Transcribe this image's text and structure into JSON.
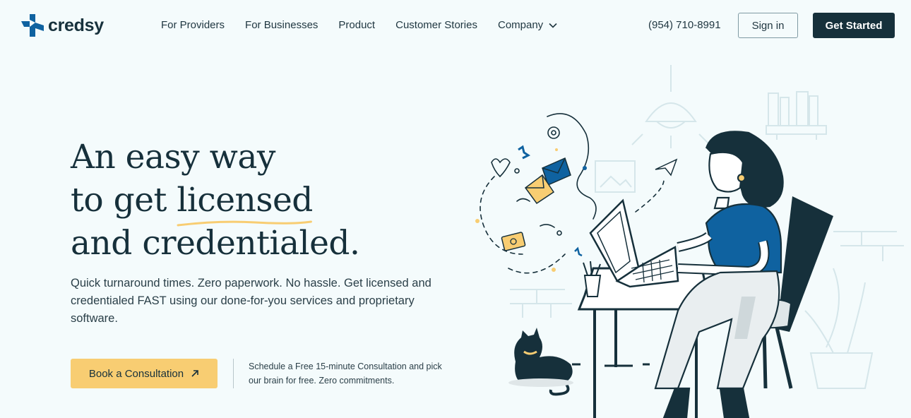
{
  "brand": {
    "name": "credsy",
    "colors": {
      "dark": "#16303b",
      "blue": "#0f62a0",
      "yellow": "#f8cd72",
      "background": "#f4fbfc"
    }
  },
  "nav": {
    "items": [
      {
        "label": "For Providers"
      },
      {
        "label": "For Businesses"
      },
      {
        "label": "Product"
      },
      {
        "label": "Customer Stories"
      },
      {
        "label": "Company",
        "icon": "chevron-down-icon"
      }
    ],
    "phone": "(954) 710-8991",
    "signin_label": "Sign in",
    "get_started_label": "Get Started"
  },
  "hero": {
    "title_line1": "An easy way",
    "title_line2_prefix": "to get ",
    "title_line2_highlight": "licensed",
    "title_line3": "and credentialed.",
    "description": "Quick turnaround times. Zero paperwork. No hassle. Get licensed and credentialed FAST using our done-for-you services and proprietary software.",
    "cta_label": "Book a Consultation",
    "cta_icon": "arrow-up-right-icon",
    "cta_note": "Schedule a Free 15-minute Consultation and pick our brain for free. Zero commitments."
  }
}
